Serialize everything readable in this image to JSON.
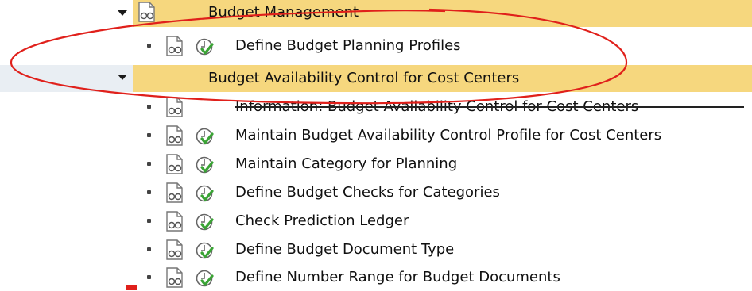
{
  "tree": {
    "header": {
      "label": "Budget Management",
      "expanded": true
    },
    "header_items": [
      {
        "label": "Define Budget Planning Profiles",
        "has_execute_icon": true
      }
    ],
    "section": {
      "label": "Budget Availability Control for Cost Centers",
      "expanded": true
    },
    "section_items": [
      {
        "label": "Information: Budget Availability Control for Cost Centers",
        "has_execute_icon": false,
        "struck_through": true
      },
      {
        "label": "Maintain Budget Availability Control Profile for Cost Centers",
        "has_execute_icon": true
      },
      {
        "label": "Maintain Category for Planning",
        "has_execute_icon": true
      },
      {
        "label": "Define Budget Checks for Categories",
        "has_execute_icon": true
      },
      {
        "label": "Check Prediction Ledger",
        "has_execute_icon": true
      },
      {
        "label": "Define Budget Document Type",
        "has_execute_icon": true
      },
      {
        "label": "Define Number Range for Budget Documents",
        "has_execute_icon": true
      }
    ]
  },
  "icons": {
    "documentation": "doc-glasses-icon",
    "execute": "clock-check-icon",
    "expand": "triangle-down-icon"
  },
  "colors": {
    "highlight_row": "#f6d77e",
    "selected_row": "#eaf1f7",
    "annotation": "#e0201b",
    "check_green": "#3aa335"
  }
}
